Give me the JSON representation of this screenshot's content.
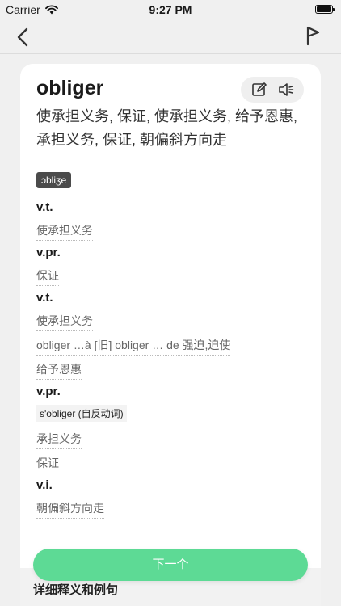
{
  "status_bar": {
    "carrier": "Carrier",
    "time": "9:27 PM",
    "icons": [
      "wifi-icon",
      "battery-icon"
    ]
  },
  "nav": {
    "icons": [
      "back-icon",
      "flag-icon"
    ]
  },
  "card": {
    "word": "obliger",
    "meaning": "使承担义务, 保证, 使承担义务, 给予恩惠, 承担义务, 保证, 朝偏斜方向走",
    "phonetic": "ɔbliʒe",
    "tool_icons": [
      "edit-icon",
      "speaker-icon"
    ],
    "definitions": [
      {
        "pos": "v.t.",
        "items": [
          {
            "type": "gloss",
            "text": "使承担义务"
          }
        ]
      },
      {
        "pos": "v.pr.",
        "items": [
          {
            "type": "gloss",
            "text": "保证"
          }
        ]
      },
      {
        "pos": "v.t.",
        "items": [
          {
            "type": "gloss",
            "text": "使承担义务"
          },
          {
            "type": "gloss",
            "text": "obliger …à [旧] obliger … de 强迫,迫使"
          },
          {
            "type": "gloss",
            "text": "给予恩惠"
          }
        ]
      },
      {
        "pos": "v.pr.",
        "items": [
          {
            "type": "tag",
            "text": "s'obliger (自反动词)"
          },
          {
            "type": "gloss",
            "text": "承担义务"
          },
          {
            "type": "gloss",
            "text": "保证"
          }
        ]
      },
      {
        "pos": "v.i.",
        "items": [
          {
            "type": "gloss",
            "text": "朝偏斜方向走"
          }
        ]
      }
    ]
  },
  "next_button": "下一个",
  "detail_section": {
    "title": "详细释义和例句"
  },
  "colors": {
    "background": "#f0f0f0",
    "card": "#ffffff",
    "accent": "#5dda95",
    "phonetic_bg": "#4b4b4b"
  }
}
